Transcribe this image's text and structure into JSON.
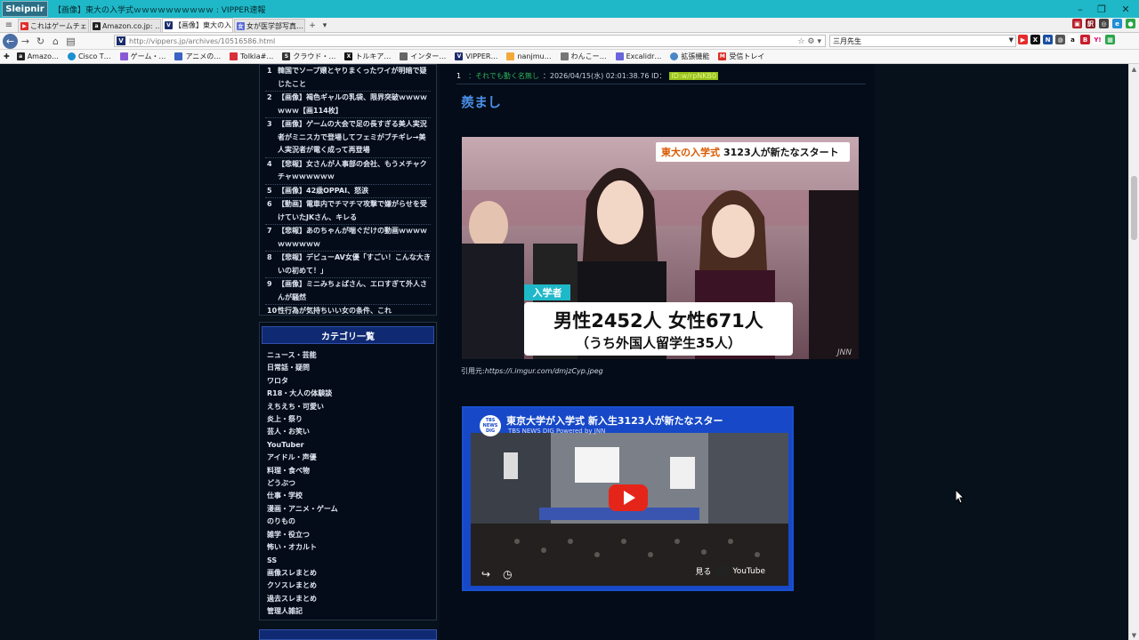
{
  "app": {
    "name": "Sleipnir",
    "window_title": "【画像】東大の入学式ｗｗｗｗｗｗｗｗｗｗ : VIPPER速報"
  },
  "tabs": [
    {
      "label": "これはゲームチェン…",
      "icon": "youtube-icon",
      "color": "#e52b2b",
      "active": false
    },
    {
      "label": "Amazon.co.jp: …",
      "icon": "amazon-icon",
      "color": "#222222",
      "active": false
    },
    {
      "label": "【画像】東大の入…",
      "icon": "vipper-icon",
      "color": "#1c2c6b",
      "active": true
    },
    {
      "label": "女が医学部写真…",
      "icon": "site-icon",
      "color": "#5a6ad8",
      "active": false
    }
  ],
  "navbar": {
    "url": "http://vippers.jp/archives/10516586.html",
    "search_value": "三月先生"
  },
  "bookmarks": [
    {
      "label": "Amazo…",
      "icon": "amazon-icon",
      "color": "#222222"
    },
    {
      "label": "Cisco T…",
      "icon": "cisco-icon",
      "color": "#1b8fd1"
    },
    {
      "label": "ゲーム・…",
      "icon": "game-icon",
      "color": "#8a5ad6"
    },
    {
      "label": "アニメの…",
      "icon": "anime-icon",
      "color": "#3b62c4"
    },
    {
      "label": "Tolkia#…",
      "icon": "tolkia-icon",
      "color": "#d8303a"
    },
    {
      "label": "クラウド・…",
      "icon": "se-icon",
      "color": "#333333"
    },
    {
      "label": "トルキア…",
      "icon": "x-icon",
      "color": "#111111"
    },
    {
      "label": "インター…",
      "icon": "inter-icon",
      "color": "#666666"
    },
    {
      "label": "VIPPER…",
      "icon": "vipper-icon",
      "color": "#1c2c6b"
    },
    {
      "label": "nanjmu…",
      "icon": "nanj-icon",
      "color": "#f2a93b"
    },
    {
      "label": "わんこー…",
      "icon": "wanko-icon",
      "color": "#777777"
    },
    {
      "label": "Excalidr…",
      "icon": "excalidraw-icon",
      "color": "#6965db"
    },
    {
      "label": "拡張機能",
      "icon": "extension-icon",
      "color": "#4a86c8"
    },
    {
      "label": "受信トレイ",
      "icon": "gmail-icon",
      "color": "#d93025"
    }
  ],
  "ranking": [
    {
      "num": "1",
      "text": "韓国でソープ嬢とヤりまくったワイが明暗で疑じたこと"
    },
    {
      "num": "2",
      "text": "【画像】褐色ギャルの乳袋、限界突破ｗｗｗｗｗｗｗ【画114枚】"
    },
    {
      "num": "3",
      "text": "【画像】ゲームの大会で足の長すぎる美人実況者がミニスカで登場してフェミがブチギレ→美人実況者が電く成って再登場"
    },
    {
      "num": "4",
      "text": "【悲報】女さんが人事部の会社、もうメチャクチャｗｗｗｗｗｗ"
    },
    {
      "num": "5",
      "text": "【画像】42歳OPPAI、怒涙"
    },
    {
      "num": "6",
      "text": "【動画】電車内でチマチマ攻撃で嫌がらせを受けていたJKさん、キレる"
    },
    {
      "num": "7",
      "text": "【悲報】あのちゃんが喘ぐだけの動画ｗｗｗｗｗｗｗｗｗｗ"
    },
    {
      "num": "8",
      "text": "【悲報】デビューAV女優「すごい！こんな大きいの初めて！」"
    },
    {
      "num": "9",
      "text": "【画像】ミニみちょぱさん、エロすぎて外人さんが騒然"
    },
    {
      "num": "10",
      "text": "性行為が気持ちいい女の条件、これ"
    }
  ],
  "categories": {
    "heading": "カテゴリ一覧",
    "items": [
      "ニュース・芸能",
      "日常話・疑問",
      "ワロタ",
      "R18・大人の体験談",
      "えちえち・可愛い",
      "炎上・祭り",
      "芸人・お笑い",
      "YouTuber",
      "アイドル・声優",
      "料理・食べ物",
      "どうぶつ",
      "仕事・学校",
      "漫画・アニメ・ゲーム",
      "のりもの",
      "雑学・役立つ",
      "怖い・オカルト",
      "SS",
      "画像スレまとめ",
      "クソスレまとめ",
      "過去スレまとめ",
      "管理人雑記"
    ]
  },
  "post": {
    "number": "1",
    "name": "：それでも動く名無し",
    "date": "：2026/04/15(水) 02:01:38.76 ID：",
    "id": "ID:w/rpNKB0",
    "body": "羨まし"
  },
  "image": {
    "banner_prefix": "東大の入学式",
    "banner_main": "3123人が新たなスタート",
    "badge": "入学者",
    "stat_line1": "男性2452人 女性671人",
    "stat_line2": "（うち外国人留学生35人）",
    "watermark": "JNN"
  },
  "citation": {
    "prefix": "引用元:",
    "url": "https://i.imgur.com/dmjzCyp.jpeg"
  },
  "video": {
    "title": "東京大学が入学式 新入生3123人が新たなスター",
    "channel": "TBS NEWS DIG Powered by JNN",
    "logo": "TBS NEWS DIG",
    "watch_label": "見る",
    "platform": "YouTube"
  }
}
